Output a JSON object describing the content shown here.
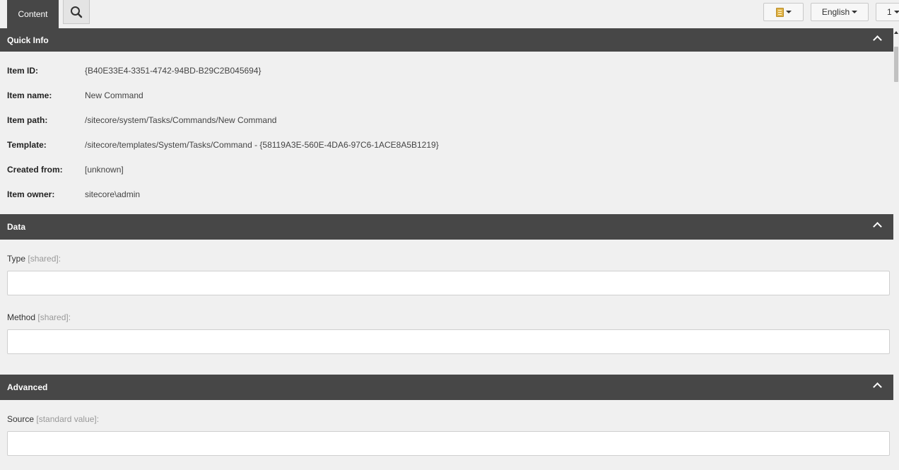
{
  "toolbar": {
    "tab_content_label": "Content",
    "search_icon": "search-icon",
    "database_icon": "book-icon",
    "language_label": "English",
    "version_label": "1"
  },
  "quick_info": {
    "title": "Quick Info",
    "rows": [
      {
        "label": "Item ID:",
        "value": "{B40E33E4-3351-4742-94BD-B29C2B045694}"
      },
      {
        "label": "Item name:",
        "value": "New Command"
      },
      {
        "label": "Item path:",
        "value": "/sitecore/system/Tasks/Commands/New Command"
      },
      {
        "label": "Template:",
        "value": "/sitecore/templates/System/Tasks/Command - {58119A3E-560E-4DA6-97C6-1ACE8A5B1219}"
      },
      {
        "label": "Created from:",
        "value": "[unknown]"
      },
      {
        "label": "Item owner:",
        "value": "sitecore\\admin"
      }
    ]
  },
  "data_section": {
    "title": "Data",
    "fields": [
      {
        "label": "Type",
        "hint": "[shared]",
        "suffix": ":",
        "value": ""
      },
      {
        "label": "Method",
        "hint": "[shared]",
        "suffix": ":",
        "value": ""
      }
    ]
  },
  "advanced_section": {
    "title": "Advanced",
    "fields": [
      {
        "label": "Source",
        "hint": "[standard value]",
        "suffix": ":",
        "value": ""
      }
    ]
  }
}
